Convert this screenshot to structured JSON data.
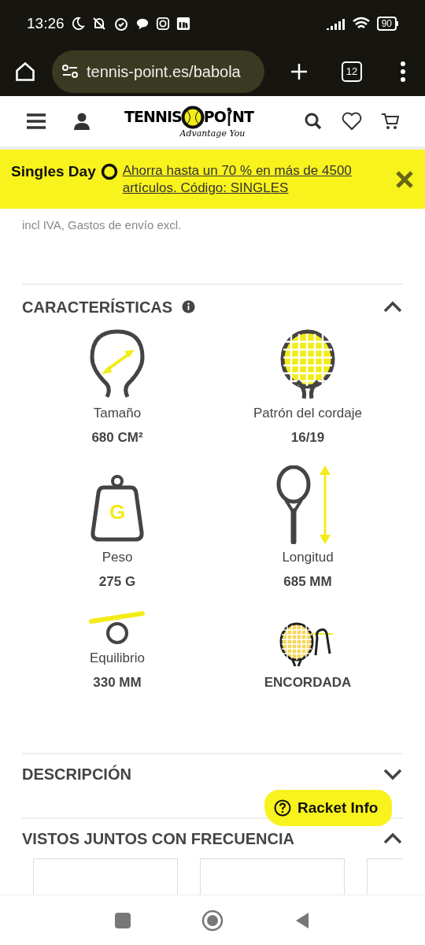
{
  "status_bar": {
    "time": "13:26",
    "battery": "90"
  },
  "browser": {
    "url": "tennis-point.es/babola",
    "tab_count": "12"
  },
  "logo": {
    "left": "TENNIS",
    "right_start": "PO",
    "right_end": "NT",
    "tagline": "Advantage You"
  },
  "promo": {
    "title": "Singles Day",
    "link": "Ahorra hasta un 70 % en más de 4500 artículos. Código: SINGLES"
  },
  "price_note": "incl IVA, Gastos de envío excl.",
  "sections": [
    {
      "kind": "specs",
      "title": "CARACTERÍSTICAS",
      "info": true,
      "expanded": true,
      "items": [
        {
          "kind": "size",
          "label": "Tamaño",
          "value": "680 CM²"
        },
        {
          "kind": "pattern",
          "label": "Patrón del cordaje",
          "value": "16/19"
        },
        {
          "kind": "weight",
          "label": "Peso",
          "value": "275 G",
          "glyph": "G"
        },
        {
          "kind": "length",
          "label": "Longitud",
          "value": "685 MM"
        },
        {
          "kind": "balance",
          "label": "Equilibrio",
          "value": "330 MM"
        },
        {
          "kind": "strung",
          "value": "ENCORDADA"
        }
      ]
    },
    {
      "title": "DESCRIPCIÓN",
      "expanded": false
    },
    {
      "kind": "carousel",
      "title": "VISTOS JUNTOS CON FRECUENCIA",
      "expanded": true
    }
  ],
  "float_button": "Racket Info"
}
